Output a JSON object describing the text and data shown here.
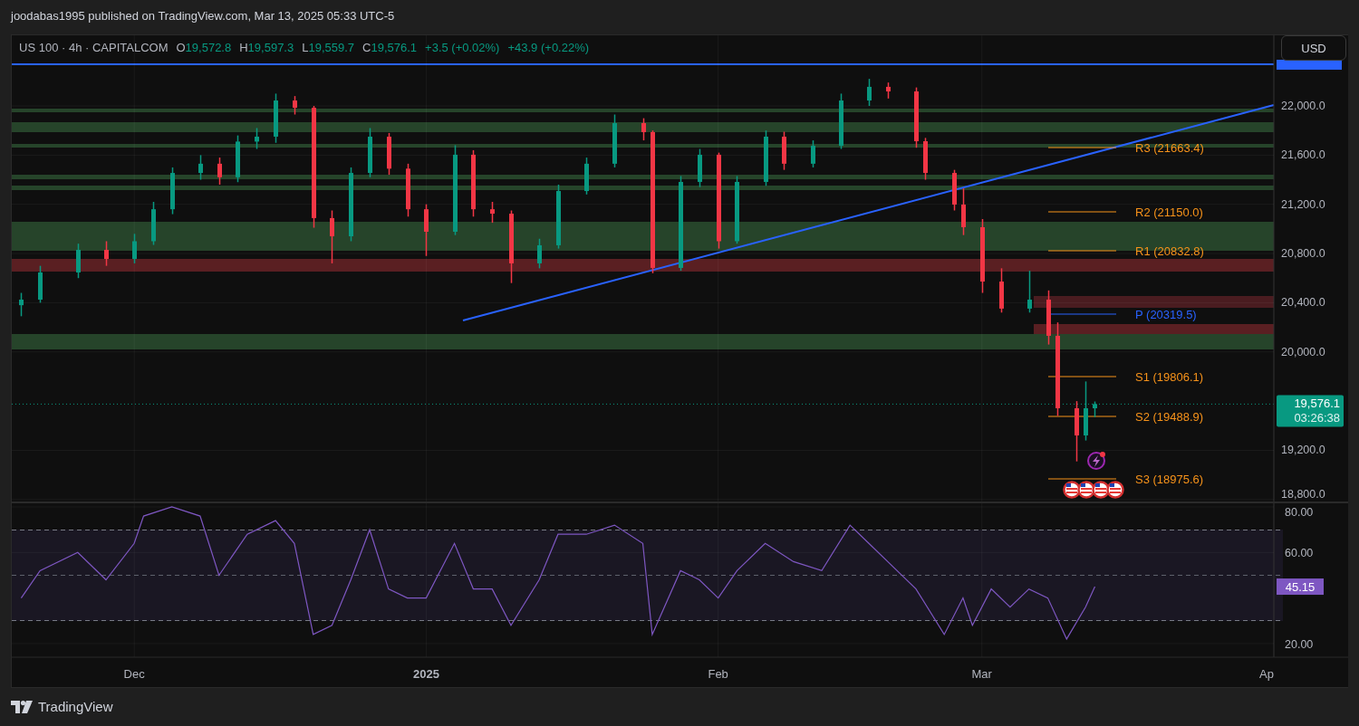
{
  "header": {
    "text": "joodabas1995 published on TradingView.com, Mar 13, 2025 05:33 UTC-5"
  },
  "legend": {
    "symbol": "US 100 · 4h · CAPITALCOM",
    "ohlc": [
      {
        "key": "O",
        "value": "19,572.8"
      },
      {
        "key": "H",
        "value": "19,597.3"
      },
      {
        "key": "L",
        "value": "19,559.7"
      },
      {
        "key": "C",
        "value": "19,576.1"
      }
    ],
    "changes": [
      "+3.5 (+0.02%)",
      "+43.9 (+0.22%)"
    ]
  },
  "currency_button": {
    "label": "USD"
  },
  "price_chart": {
    "chart_data": {
      "type": "candlestick",
      "xlim": [
        "2024-11-18",
        "2025-04-01"
      ],
      "ylim": [
        18784,
        22574
      ],
      "yticks": [
        {
          "value": 18800,
          "label": "18,800.0"
        },
        {
          "value": 19200,
          "label": "19,200.0"
        },
        {
          "value": 20000,
          "label": "20,000.0"
        },
        {
          "value": 20400,
          "label": "20,400.0"
        },
        {
          "value": 20800,
          "label": "20,800.0"
        },
        {
          "value": 21200,
          "label": "21,200.0"
        },
        {
          "value": 21600,
          "label": "21,600.0"
        },
        {
          "value": 22000,
          "label": "22,000.0"
        }
      ],
      "x": [
        "2024-11-19",
        "2024-11-21",
        "2024-11-25",
        "2024-11-28",
        "2024-12-01",
        "2024-12-03",
        "2024-12-05",
        "2024-12-08",
        "2024-12-10",
        "2024-12-12",
        "2024-12-14",
        "2024-12-16",
        "2024-12-18",
        "2024-12-20",
        "2024-12-22",
        "2024-12-24",
        "2024-12-26",
        "2024-12-28",
        "2024-12-30",
        "2025-01-01",
        "2025-01-04",
        "2025-01-06",
        "2025-01-08",
        "2025-01-10",
        "2025-01-13",
        "2025-01-15",
        "2025-01-18",
        "2025-01-21",
        "2025-01-24",
        "2025-01-25",
        "2025-01-28",
        "2025-01-30",
        "2025-02-01",
        "2025-02-03",
        "2025-02-06",
        "2025-02-08",
        "2025-02-11",
        "2025-02-14",
        "2025-02-17",
        "2025-02-19",
        "2025-02-22",
        "2025-02-23",
        "2025-02-26",
        "2025-02-27",
        "2025-03-01",
        "2025-03-03",
        "2025-03-06",
        "2025-03-08",
        "2025-03-09",
        "2025-03-11",
        "2025-03-12",
        "2025-03-13"
      ],
      "ohlc": [
        [
          20380,
          20480,
          20290,
          20425
        ],
        [
          20425,
          20700,
          20400,
          20646
        ],
        [
          20646,
          20880,
          20600,
          20830
        ],
        [
          20830,
          20900,
          20700,
          20756
        ],
        [
          20756,
          20960,
          20720,
          20900
        ],
        [
          20900,
          21220,
          20870,
          21160
        ],
        [
          21160,
          21500,
          21120,
          21455
        ],
        [
          21455,
          21600,
          21400,
          21530
        ],
        [
          21530,
          21580,
          21360,
          21420
        ],
        [
          21420,
          21760,
          21380,
          21710
        ],
        [
          21710,
          21820,
          21650,
          21750
        ],
        [
          21750,
          22100,
          21700,
          22044
        ],
        [
          22044,
          22080,
          21930,
          21985
        ],
        [
          21985,
          22000,
          21010,
          21088
        ],
        [
          21088,
          21150,
          20720,
          20940
        ],
        [
          20940,
          21500,
          20900,
          21455
        ],
        [
          21455,
          21820,
          21420,
          21750
        ],
        [
          21750,
          21780,
          21440,
          21490
        ],
        [
          21490,
          21530,
          21100,
          21160
        ],
        [
          21160,
          21200,
          20780,
          20977
        ],
        [
          20977,
          21680,
          20950,
          21603
        ],
        [
          21603,
          21640,
          21100,
          21160
        ],
        [
          21160,
          21220,
          21050,
          21124
        ],
        [
          21124,
          21150,
          20560,
          20720
        ],
        [
          20720,
          20920,
          20680,
          20867
        ],
        [
          20867,
          21360,
          20840,
          21308
        ],
        [
          21308,
          21580,
          21280,
          21530
        ],
        [
          21530,
          21930,
          21500,
          21860
        ],
        [
          21860,
          21900,
          21720,
          21787
        ],
        [
          21787,
          21800,
          20640,
          20683
        ],
        [
          20683,
          21430,
          20660,
          21382
        ],
        [
          21382,
          21650,
          21340,
          21603
        ],
        [
          21603,
          21620,
          20840,
          20900
        ],
        [
          20900,
          21430,
          20880,
          21382
        ],
        [
          21382,
          21800,
          21350,
          21750
        ],
        [
          21750,
          21790,
          21480,
          21530
        ],
        [
          21530,
          21720,
          21500,
          21676
        ],
        [
          21676,
          22100,
          21650,
          22044
        ],
        [
          22044,
          22220,
          22000,
          22155
        ],
        [
          22155,
          22190,
          22060,
          22118
        ],
        [
          22118,
          22150,
          21660,
          21713
        ],
        [
          21713,
          21740,
          21400,
          21455
        ],
        [
          21455,
          21480,
          21150,
          21198
        ],
        [
          21198,
          21330,
          20950,
          21014
        ],
        [
          21014,
          21080,
          20480,
          20572
        ],
        [
          20572,
          20680,
          20320,
          20352
        ],
        [
          20352,
          20660,
          20320,
          20425
        ],
        [
          20425,
          20500,
          20060,
          20131
        ],
        [
          20131,
          20240,
          19480,
          19542
        ],
        [
          19542,
          19600,
          19110,
          19321
        ],
        [
          19321,
          19760,
          19280,
          19542
        ],
        [
          19542,
          19597,
          19470,
          19576
        ]
      ],
      "grid": true
    },
    "pivots": [
      {
        "label": "R3 (21663.4)",
        "color": "#f7931a"
      },
      {
        "label": "R2 (21150.0)",
        "color": "#f7931a"
      },
      {
        "label": "R1 (20832.8)",
        "color": "#f7931a"
      },
      {
        "label": "P (20319.5)",
        "color": "#2962ff"
      },
      {
        "label": "S1 (19806.1)",
        "color": "#f7931a"
      },
      {
        "label": "S2 (19488.9)",
        "color": "#f7931a"
      },
      {
        "label": "S3 (18975.6)",
        "color": "#f7931a"
      }
    ],
    "zones": [
      {
        "color": "#26442a"
      },
      {
        "color": "#26442a"
      },
      {
        "color": "#26442a"
      },
      {
        "color": "#26442a"
      },
      {
        "color": "#26442a"
      },
      {
        "color": "#26442a"
      },
      {
        "color": "#5a1f22"
      },
      {
        "color": "#4a1c20"
      },
      {
        "color": "#5a1f22"
      },
      {
        "color": "#26442a"
      }
    ],
    "last_price": {
      "price": "19,576.1",
      "countdown": "03:26:38"
    }
  },
  "rsi_chart": {
    "chart_data": {
      "type": "line",
      "xlim": [
        "2024-11-18",
        "2025-04-01"
      ],
      "ylim": [
        14,
        81.6
      ],
      "xticks": [
        {
          "value": "2024-12-01",
          "label": "Dec"
        },
        {
          "value": "2025-01-01",
          "label": "2025"
        },
        {
          "value": "2025-02-01",
          "label": "Feb"
        },
        {
          "value": "2025-03-01",
          "label": "Mar"
        },
        {
          "value": "2025-04-01",
          "label": "Ap"
        }
      ],
      "yticks": [
        {
          "value": 20,
          "label": "20.00"
        },
        {
          "value": 60,
          "label": "60.00"
        },
        {
          "value": 80,
          "label": "80.00"
        }
      ],
      "x": [
        "2024-11-19",
        "2024-11-21",
        "2024-11-25",
        "2024-11-28",
        "2024-12-01",
        "2024-12-02",
        "2024-12-05",
        "2024-12-08",
        "2024-12-10",
        "2024-12-13",
        "2024-12-16",
        "2024-12-18",
        "2024-12-20",
        "2024-12-22",
        "2024-12-24",
        "2024-12-26",
        "2024-12-28",
        "2024-12-30",
        "2025-01-01",
        "2025-01-04",
        "2025-01-06",
        "2025-01-08",
        "2025-01-10",
        "2025-01-13",
        "2025-01-15",
        "2025-01-18",
        "2025-01-21",
        "2025-01-24",
        "2025-01-25",
        "2025-01-28",
        "2025-01-30",
        "2025-02-01",
        "2025-02-03",
        "2025-02-06",
        "2025-02-09",
        "2025-02-12",
        "2025-02-15",
        "2025-02-17",
        "2025-02-19",
        "2025-02-22",
        "2025-02-25",
        "2025-02-27",
        "2025-02-28",
        "2025-03-02",
        "2025-03-04",
        "2025-03-06",
        "2025-03-08",
        "2025-03-10",
        "2025-03-12",
        "2025-03-13"
      ],
      "series": [
        {
          "color": "#7e57c2",
          "values": [
            40,
            52,
            60,
            48,
            64,
            76,
            80,
            76,
            50,
            68,
            74,
            64,
            24,
            28,
            48,
            70,
            44,
            40,
            40,
            64,
            44,
            44,
            28,
            48,
            68,
            68,
            72,
            64,
            24,
            52,
            48,
            40,
            52,
            64,
            56,
            52,
            72,
            64,
            56,
            44,
            24,
            40,
            28,
            44,
            36,
            44,
            40,
            22,
            36,
            45
          ]
        }
      ],
      "grid": true
    },
    "current_value": "45.15"
  },
  "footer": {
    "brand": "TradingView"
  }
}
